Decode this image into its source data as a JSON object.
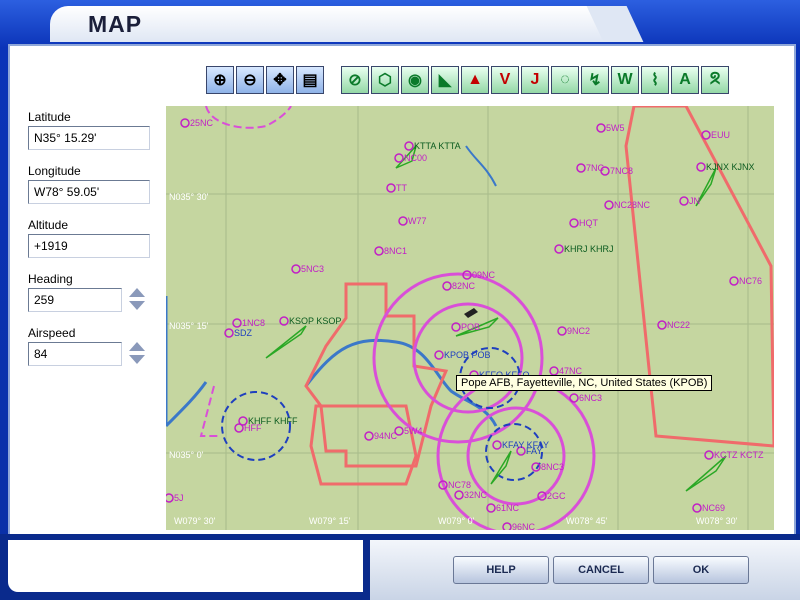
{
  "window": {
    "title": "MAP"
  },
  "toolbar": {
    "zoom_tools": [
      {
        "icon": "zoom-in-icon",
        "glyph": "⊕"
      },
      {
        "icon": "zoom-out-icon",
        "glyph": "⊖"
      },
      {
        "icon": "center-icon",
        "glyph": "✥"
      },
      {
        "icon": "print-icon",
        "glyph": "▤"
      }
    ],
    "filters": [
      {
        "icon": "airport-filter-icon",
        "glyph": "⊘"
      },
      {
        "icon": "vor-filter-icon",
        "glyph": "⬡"
      },
      {
        "icon": "ndb-filter-icon",
        "glyph": "◉"
      },
      {
        "icon": "ils-filter-icon",
        "glyph": "◣"
      },
      {
        "icon": "intersection-filter-icon",
        "glyph": "▲"
      },
      {
        "icon": "victor-airway-icon",
        "glyph": "V"
      },
      {
        "icon": "jet-airway-icon",
        "glyph": "J"
      },
      {
        "icon": "airspace-filter-icon",
        "glyph": "◌"
      },
      {
        "icon": "route-filter-icon",
        "glyph": "↯"
      },
      {
        "icon": "weather-filter-icon",
        "glyph": "W"
      },
      {
        "icon": "terrain-filter-icon",
        "glyph": "⌇"
      },
      {
        "icon": "label-filter-icon",
        "glyph": "A"
      },
      {
        "icon": "flight-path-filter-icon",
        "glyph": "ᘝ"
      }
    ]
  },
  "fields": {
    "latitude": {
      "label": "Latitude",
      "value": "N35° 15.29'"
    },
    "longitude": {
      "label": "Longitude",
      "value": "W78° 59.05'"
    },
    "altitude": {
      "label": "Altitude",
      "value": "+1919"
    },
    "heading": {
      "label": "Heading",
      "value": "259"
    },
    "airspeed": {
      "label": "Airspeed",
      "value": "84"
    }
  },
  "map": {
    "tooltip": "Pope AFB, Fayetteville, NC, United States (KPOB)",
    "colors": {
      "land": "#c5d6a0",
      "class_b": "#d94fd8",
      "class_d": "#1e3fbf",
      "restricted": "#f06b6b",
      "river": "#3b78c9"
    },
    "coords": {
      "lat_top": "N035° 30'",
      "lat_mid": "N035° 15'",
      "lat_bot": "N035° 0'",
      "lon_1": "W079° 30'",
      "lon_2": "W079° 15'",
      "lon_3": "W079° 0'",
      "lon_4": "W078° 45'",
      "lon_5": "W078° 30'"
    },
    "labels": [
      {
        "id": "25nc",
        "text": "25NC"
      },
      {
        "id": "ktta",
        "text": "KTTA KTTA"
      },
      {
        "id": "nc00",
        "text": "NC00"
      },
      {
        "id": "tt",
        "text": "TT"
      },
      {
        "id": "5w5",
        "text": "5W5"
      },
      {
        "id": "7nc",
        "text": "7NC"
      },
      {
        "id": "7nc8",
        "text": "7NC8"
      },
      {
        "id": "euu",
        "text": "EUU"
      },
      {
        "id": "kjnx",
        "text": "KJNX KJNX"
      },
      {
        "id": "jn",
        "text": "JN"
      },
      {
        "id": "hqt",
        "text": "HQT"
      },
      {
        "id": "nc28nc",
        "text": "NC28NC"
      },
      {
        "id": "w77",
        "text": "W77"
      },
      {
        "id": "khrj",
        "text": "KHRJ KHRJ"
      },
      {
        "id": "8nc1",
        "text": "8NC1"
      },
      {
        "id": "5nc3",
        "text": "5NC3"
      },
      {
        "id": "09nc",
        "text": "09NC"
      },
      {
        "id": "82nc",
        "text": "82NC"
      },
      {
        "id": "nc76",
        "text": "NC76"
      },
      {
        "id": "1nc8",
        "text": "1NC8"
      },
      {
        "id": "ksop",
        "text": "KSOP KSOP"
      },
      {
        "id": "pob",
        "text": "POB"
      },
      {
        "id": "9nc2",
        "text": "9NC2"
      },
      {
        "id": "nc22",
        "text": "NC22"
      },
      {
        "id": "sdz",
        "text": "SDZ"
      },
      {
        "id": "kpob",
        "text": "KPOB POB"
      },
      {
        "id": "kffo",
        "text": "KFFO KFFO"
      },
      {
        "id": "47nc",
        "text": "47NC"
      },
      {
        "id": "6nc3",
        "text": "6NC3"
      },
      {
        "id": "khff",
        "text": "KHFF KHFF"
      },
      {
        "id": "hff",
        "text": "HFF"
      },
      {
        "id": "5w4",
        "text": "5W4"
      },
      {
        "id": "94nc",
        "text": "94NC"
      },
      {
        "id": "kfay",
        "text": "KFAY KFAY"
      },
      {
        "id": "fay",
        "text": "FAY"
      },
      {
        "id": "8nc3",
        "text": "8NC3"
      },
      {
        "id": "kctz",
        "text": "KCTZ KCTZ"
      },
      {
        "id": "nc78",
        "text": "NC78"
      },
      {
        "id": "32nc",
        "text": "32NC"
      },
      {
        "id": "2gc",
        "text": "2GC"
      },
      {
        "id": "61nc",
        "text": "61NC"
      },
      {
        "id": "nc69",
        "text": "NC69"
      },
      {
        "id": "5j",
        "text": "5J"
      },
      {
        "id": "96nc",
        "text": "96NC"
      }
    ]
  },
  "buttons": {
    "help": "HELP",
    "cancel": "CANCEL",
    "ok": "OK"
  }
}
